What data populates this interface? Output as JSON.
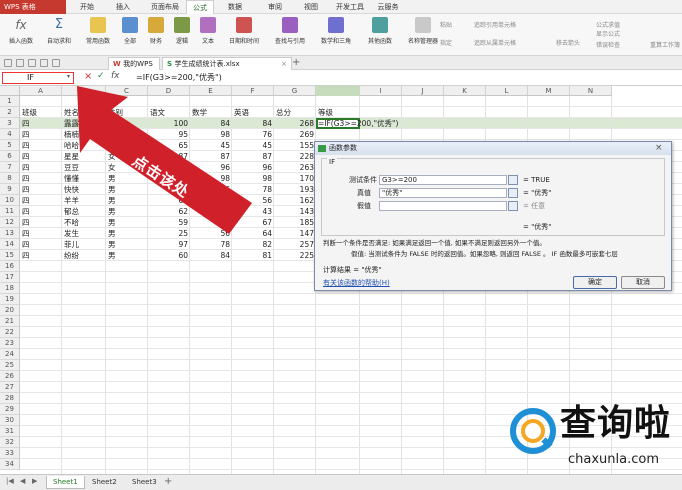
{
  "app": {
    "logo": "WPS 表格"
  },
  "menu_tabs": [
    "开始",
    "插入",
    "页面布局",
    "公式",
    "数据",
    "审阅",
    "视图",
    "开发工具",
    "云服务"
  ],
  "active_menu": "公式",
  "ribbon": {
    "buttons": [
      "插入函数",
      "自动求和",
      "常用函数",
      "全部",
      "财务",
      "逻辑",
      "文本",
      "日期和时间",
      "查找与引用",
      "数学和三角",
      "其他函数",
      "名称管理器",
      "粘贴",
      "指定",
      "追踪引用单元格",
      "追踪从属单元格",
      "移去箭头",
      "公式求值",
      "显示公式",
      "错误检查",
      "重算工作簿"
    ],
    "fx_label": "fx"
  },
  "doc_tabs": [
    {
      "label": "我的WPS"
    },
    {
      "label": "学生成绩统计表.xlsx"
    }
  ],
  "formula_bar": {
    "name_box": "IF",
    "x_label": "×",
    "check_label": "✓",
    "fx_label": "fx",
    "formula": "=IF(G3>=200,\"优秀\")"
  },
  "grid": {
    "columns": [
      "A",
      "B",
      "C",
      "D",
      "E",
      "F",
      "G",
      "H",
      "I",
      "J",
      "K",
      "L",
      "M",
      "N"
    ],
    "rows": [
      "1",
      "2",
      "3",
      "4",
      "5",
      "6",
      "7",
      "8",
      "9",
      "10",
      "11",
      "12",
      "13",
      "14",
      "15",
      "16",
      "17",
      "18",
      "19",
      "20",
      "21",
      "22",
      "23",
      "24",
      "25",
      "26",
      "27",
      "28",
      "29",
      "30",
      "31",
      "32",
      "33",
      "34"
    ],
    "headers": [
      "班级",
      "姓名",
      "性别",
      "语文",
      "数学",
      "英语",
      "总分",
      "等级"
    ],
    "data": [
      [
        "四",
        "露露",
        "女",
        "100",
        "84",
        "84",
        "268"
      ],
      [
        "四",
        "楠楠",
        "男",
        "95",
        "98",
        "76",
        "269"
      ],
      [
        "四",
        "哈哈",
        "女",
        "65",
        "45",
        "45",
        "155"
      ],
      [
        "四",
        "星星",
        "女",
        "87",
        "87",
        "87",
        "228"
      ],
      [
        "四",
        "豆豆",
        "女",
        "96",
        "96",
        "96",
        "263"
      ],
      [
        "四",
        "懂懂",
        "男",
        "56",
        "98",
        "98",
        "170"
      ],
      [
        "四",
        "快快",
        "男",
        "89",
        "56",
        "78",
        "193"
      ],
      [
        "四",
        "羊羊",
        "男",
        "61",
        "45",
        "56",
        "162"
      ],
      [
        "四",
        "郁总",
        "男",
        "62",
        "49",
        "43",
        "143"
      ],
      [
        "四",
        "不哈",
        "男",
        "59",
        "67",
        "67",
        "185"
      ],
      [
        "四",
        "发生",
        "男",
        "25",
        "56",
        "64",
        "147"
      ],
      [
        "四",
        "菲儿",
        "男",
        "97",
        "78",
        "82",
        "257"
      ],
      [
        "四",
        "纷纷",
        "男",
        "60",
        "84",
        "81",
        "225"
      ]
    ],
    "h3_formula": "=IF(G3>=200,\"优秀\")"
  },
  "annotation": {
    "text": "点击该处"
  },
  "dialog": {
    "title": "函数参数",
    "func_name": "IF",
    "params": [
      {
        "label": "测试条件",
        "value": "G3>=200",
        "result": "= TRUE"
      },
      {
        "label": "真值",
        "value": "\"优秀\"",
        "result": "= \"优秀\""
      },
      {
        "label": "假值",
        "value": "",
        "result": "= 任意"
      }
    ],
    "overall_result": "= \"优秀\"",
    "description": "判断一个条件是否满足: 如果满足返回一个值, 如果不满足则返回另外一个值。",
    "param_desc": "假值:  当测试条件为 FALSE 时的返回值。如果忽略, 则返回 FALSE 。 IF 函数最多可嵌套七层",
    "calc_result": "计算结果 = \"优秀\"",
    "help_link": "有关该函数的帮助(H)",
    "ok": "确定",
    "cancel": "取消"
  },
  "sheet_tabs": [
    "Sheet1",
    "Sheet2",
    "Sheet3"
  ],
  "watermark": {
    "logo_text": "查询啦",
    "domain": "chaxunla.com"
  },
  "colors": {
    "accent_red": "#d0202a",
    "wps_red": "#c5392f",
    "selected_green": "#dbe8d4",
    "watermark_blue": "#1f8fd6",
    "watermark_orange": "#f5a623"
  }
}
